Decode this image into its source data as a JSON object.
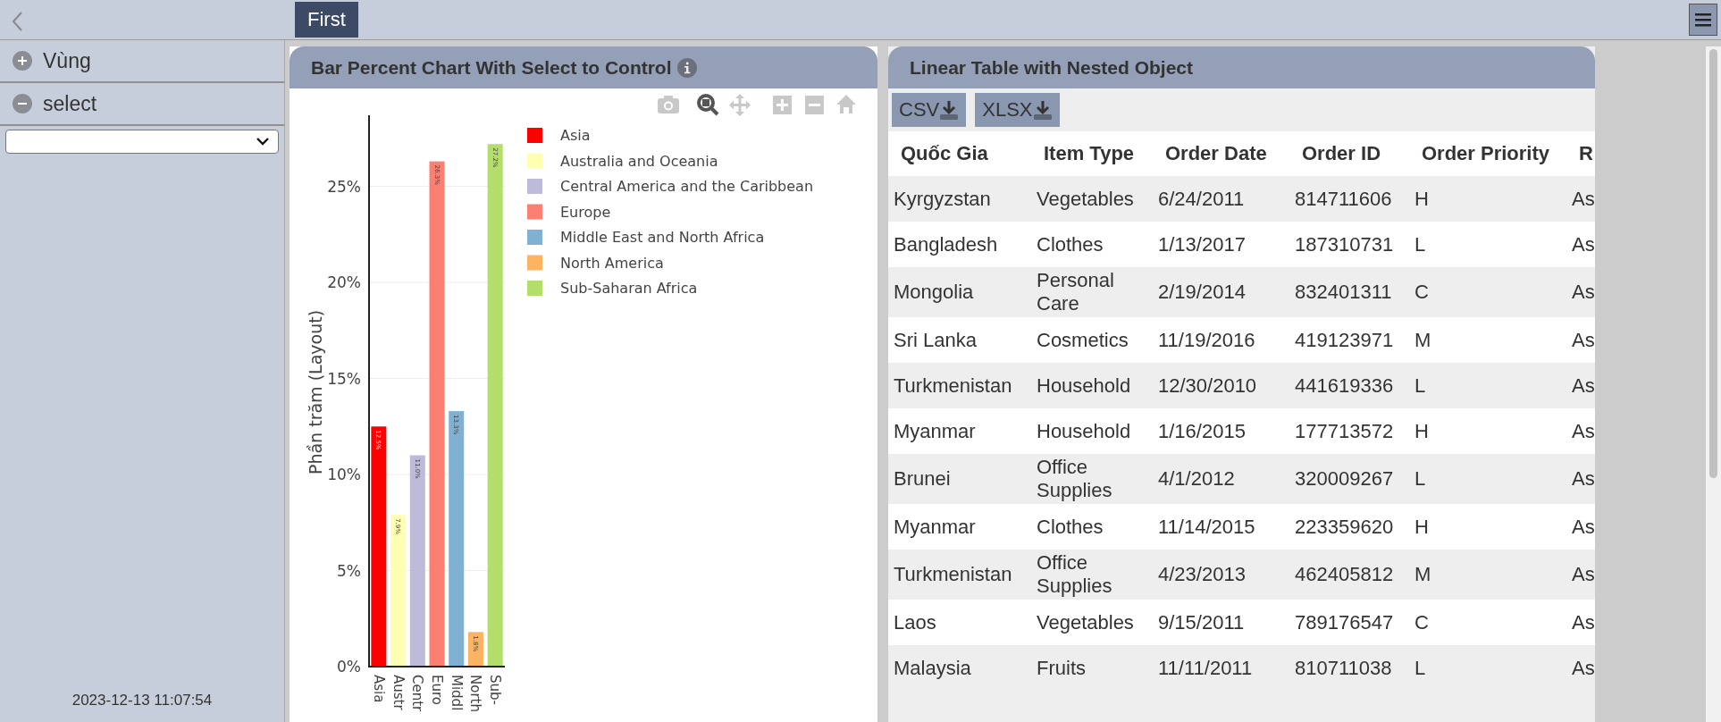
{
  "topbar": {
    "tabs": [
      {
        "label": "First",
        "selected": true
      }
    ]
  },
  "sidebar": {
    "sections": [
      {
        "label": "Vùng",
        "expanded": false
      },
      {
        "label": "select",
        "expanded": true
      }
    ],
    "timestamp": "2023-12-13 11:07:54"
  },
  "chart_panel": {
    "title": "Bar Percent Chart With Select to Control",
    "chart_data": {
      "type": "bar",
      "ylabel": "Phần trăm (Layout)",
      "categories": [
        "Asia",
        "Austr",
        "Centr",
        "Euro",
        "Middl",
        "North",
        "Sub-"
      ],
      "series": [
        {
          "name": "Asia",
          "color": "#ff0000",
          "values": [
            12.5,
            null,
            null,
            null,
            null,
            null,
            null
          ],
          "value_labels": [
            "12.5%",
            null,
            null,
            null,
            null,
            null,
            null
          ]
        },
        {
          "name": "Australia and Oceania",
          "color": "#ffffb3",
          "values": [
            null,
            7.9,
            null,
            null,
            null,
            null,
            null
          ],
          "value_labels": [
            null,
            "7.9%",
            null,
            null,
            null,
            null,
            null
          ]
        },
        {
          "name": "Central America and the Caribbean",
          "color": "#bebada",
          "values": [
            null,
            null,
            11.0,
            null,
            null,
            null,
            null
          ],
          "value_labels": [
            null,
            null,
            "11.0%",
            null,
            null,
            null,
            null
          ]
        },
        {
          "name": "Europe",
          "color": "#fb8072",
          "values": [
            null,
            null,
            null,
            26.3,
            null,
            null,
            null
          ],
          "value_labels": [
            null,
            null,
            null,
            "26.3%",
            null,
            null,
            null
          ]
        },
        {
          "name": "Middle East and North Africa",
          "color": "#80b1d3",
          "values": [
            null,
            null,
            null,
            null,
            13.3,
            null,
            null
          ],
          "value_labels": [
            null,
            null,
            null,
            null,
            "13.3%",
            null,
            null
          ]
        },
        {
          "name": "North America",
          "color": "#fdb462",
          "values": [
            null,
            null,
            null,
            null,
            null,
            1.8,
            null
          ],
          "value_labels": [
            null,
            null,
            null,
            null,
            null,
            "1.8%",
            null
          ]
        },
        {
          "name": "Sub-Saharan Africa",
          "color": "#b3de69",
          "values": [
            null,
            null,
            null,
            null,
            null,
            null,
            27.2
          ],
          "value_labels": [
            null,
            null,
            null,
            null,
            null,
            null,
            "27.2%"
          ]
        }
      ],
      "ylim": [
        0,
        28.7
      ],
      "yticks": [
        {
          "value": 0,
          "label": "0%"
        },
        {
          "value": 5,
          "label": "5%"
        },
        {
          "value": 10,
          "label": "10%"
        },
        {
          "value": 15,
          "label": "15%"
        },
        {
          "value": 20,
          "label": "20%"
        },
        {
          "value": 25,
          "label": "25%"
        }
      ],
      "grid": true,
      "legend": true
    }
  },
  "table_panel": {
    "title": "Linear Table with Nested Object",
    "export_buttons": [
      "CSV",
      "XLSX"
    ],
    "table": {
      "columns": [
        "Quốc Gia",
        "Item Type",
        "Order Date",
        "Order ID",
        "Order Priority",
        "R"
      ],
      "rows": [
        [
          "Kyrgyzstan",
          "Vegetables",
          "6/24/2011",
          "814711606",
          "H",
          "As"
        ],
        [
          "Bangladesh",
          "Clothes",
          "1/13/2017",
          "187310731",
          "L",
          "As"
        ],
        [
          "Mongolia",
          "Personal Care",
          "2/19/2014",
          "832401311",
          "C",
          "As"
        ],
        [
          "Sri Lanka",
          "Cosmetics",
          "11/19/2016",
          "419123971",
          "M",
          "As"
        ],
        [
          "Turkmenistan",
          "Household",
          "12/30/2010",
          "441619336",
          "L",
          "As"
        ],
        [
          "Myanmar",
          "Household",
          "1/16/2015",
          "177713572",
          "H",
          "As"
        ],
        [
          "Brunei",
          "Office Supplies",
          "4/1/2012",
          "320009267",
          "L",
          "As"
        ],
        [
          "Myanmar",
          "Clothes",
          "11/14/2015",
          "223359620",
          "H",
          "As"
        ],
        [
          "Turkmenistan",
          "Office Supplies",
          "4/23/2013",
          "462405812",
          "M",
          "As"
        ],
        [
          "Laos",
          "Vegetables",
          "9/15/2011",
          "789176547",
          "C",
          "As"
        ],
        [
          "Malaysia",
          "Fruits",
          "11/11/2011",
          "810711038",
          "L",
          "As"
        ]
      ]
    }
  }
}
